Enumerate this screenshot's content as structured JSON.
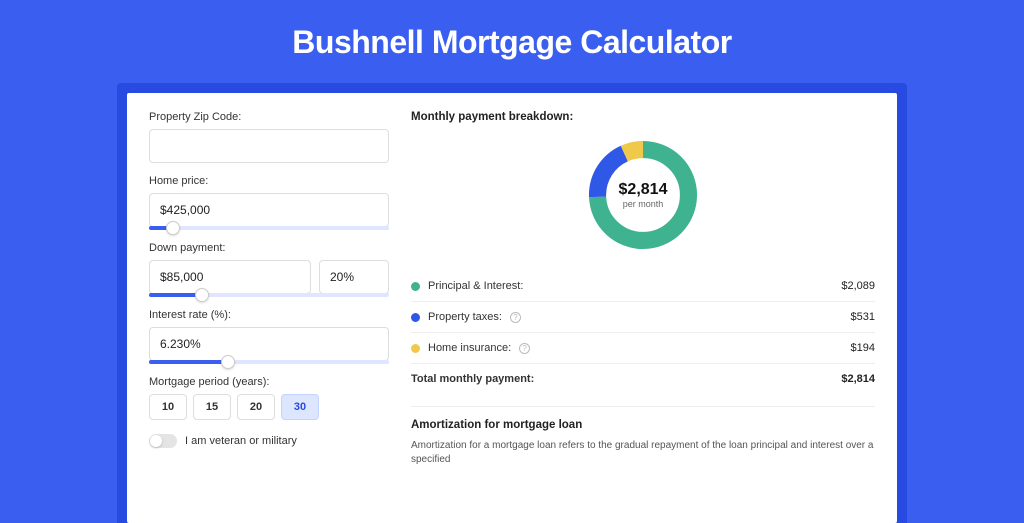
{
  "page": {
    "title": "Bushnell Mortgage Calculator"
  },
  "form": {
    "zip_label": "Property Zip Code:",
    "zip_value": "",
    "home_price_label": "Home price:",
    "home_price_value": "$425,000",
    "home_price_slider_pct": 10,
    "down_label": "Down payment:",
    "down_value": "$85,000",
    "down_pct_value": "20%",
    "down_slider_pct": 22,
    "rate_label": "Interest rate (%):",
    "rate_value": "6.230%",
    "rate_slider_pct": 33,
    "period_label": "Mortgage period (years):",
    "period_options": [
      "10",
      "15",
      "20",
      "30"
    ],
    "period_selected": "30",
    "veteran_label": "I am veteran or military"
  },
  "breakdown": {
    "title": "Monthly payment breakdown:",
    "center_amount": "$2,814",
    "center_sub": "per month",
    "items": [
      {
        "label": "Principal & Interest:",
        "value": "$2,089",
        "color": "green",
        "info": false
      },
      {
        "label": "Property taxes:",
        "value": "$531",
        "color": "blue",
        "info": true
      },
      {
        "label": "Home insurance:",
        "value": "$194",
        "color": "yellow",
        "info": true
      }
    ],
    "total_label": "Total monthly payment:",
    "total_value": "$2,814"
  },
  "amort": {
    "title": "Amortization for mortgage loan",
    "text": "Amortization for a mortgage loan refers to the gradual repayment of the loan principal and interest over a specified"
  },
  "chart_data": {
    "type": "pie",
    "title": "Monthly payment breakdown",
    "series": [
      {
        "name": "Principal & Interest",
        "value": 2089,
        "color": "#3fb28f"
      },
      {
        "name": "Property taxes",
        "value": 531,
        "color": "#2f58e6"
      },
      {
        "name": "Home insurance",
        "value": 194,
        "color": "#f0c94a"
      }
    ],
    "total": 2814,
    "center_label": "$2,814 per month"
  }
}
